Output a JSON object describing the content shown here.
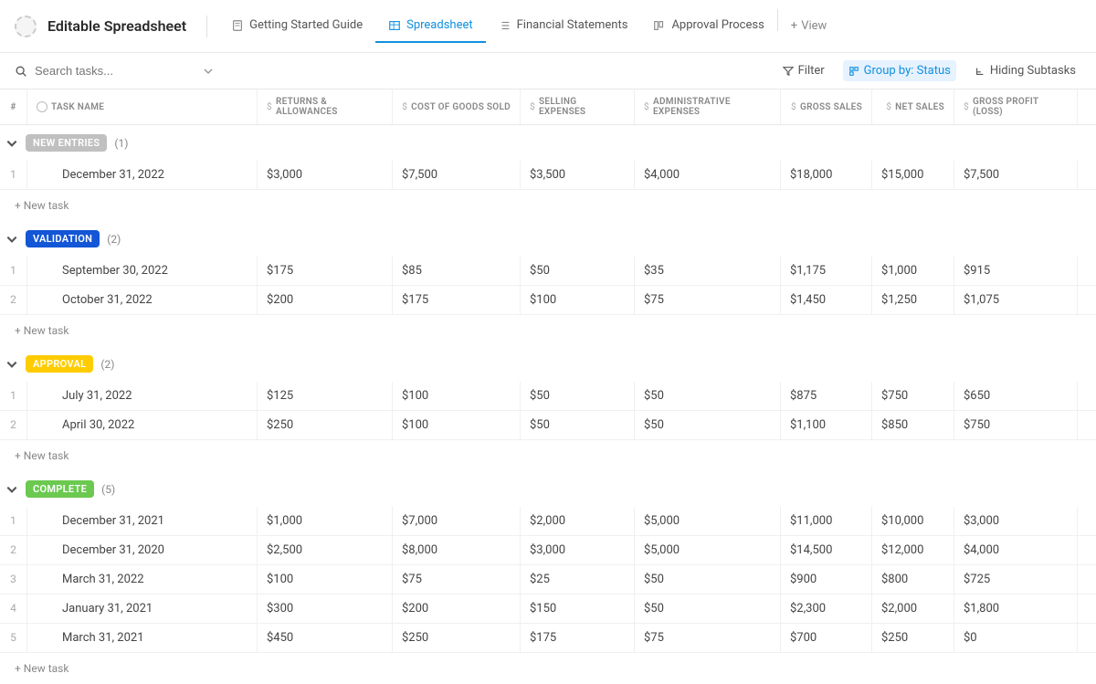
{
  "header": {
    "title": "Editable Spreadsheet",
    "tabs": [
      {
        "label": "Getting Started Guide",
        "active": false
      },
      {
        "label": "Spreadsheet",
        "active": true
      },
      {
        "label": "Financial Statements",
        "active": false
      },
      {
        "label": "Approval Process",
        "active": false
      }
    ],
    "addView": "View"
  },
  "toolbar": {
    "searchPlaceholder": "Search tasks...",
    "filter": "Filter",
    "groupBy": "Group by: Status",
    "hidingSubtasks": "Hiding Subtasks"
  },
  "columns": {
    "num": "#",
    "name": "TASK NAME",
    "returns": "RETURNS & ALLOWANCES",
    "cogs": "COST OF GOODS SOLD",
    "selling": "SELLING EXPENSES",
    "admin": "ADMINISTRATIVE EXPENSES",
    "gross": "GROSS SALES",
    "net": "NET SALES",
    "profit": "GROSS PROFIT (LOSS)"
  },
  "newTask": "+ New task",
  "groups": [
    {
      "label": "NEW ENTRIES",
      "badgeClass": "badge-new",
      "count": "(1)",
      "rows": [
        {
          "num": "1",
          "name": "December 31, 2022",
          "returns": "$3,000",
          "cogs": "$7,500",
          "selling": "$3,500",
          "admin": "$4,000",
          "gross": "$18,000",
          "net": "$15,000",
          "profit": "$7,500"
        }
      ]
    },
    {
      "label": "VALIDATION",
      "badgeClass": "badge-validation",
      "count": "(2)",
      "rows": [
        {
          "num": "1",
          "name": "September 30, 2022",
          "returns": "$175",
          "cogs": "$85",
          "selling": "$50",
          "admin": "$35",
          "gross": "$1,175",
          "net": "$1,000",
          "profit": "$915"
        },
        {
          "num": "2",
          "name": "October 31, 2022",
          "returns": "$200",
          "cogs": "$175",
          "selling": "$100",
          "admin": "$75",
          "gross": "$1,450",
          "net": "$1,250",
          "profit": "$1,075"
        }
      ]
    },
    {
      "label": "APPROVAL",
      "badgeClass": "badge-approval",
      "count": "(2)",
      "rows": [
        {
          "num": "1",
          "name": "July 31, 2022",
          "returns": "$125",
          "cogs": "$100",
          "selling": "$50",
          "admin": "$50",
          "gross": "$875",
          "net": "$750",
          "profit": "$650"
        },
        {
          "num": "2",
          "name": "April 30, 2022",
          "returns": "$250",
          "cogs": "$100",
          "selling": "$50",
          "admin": "$50",
          "gross": "$1,100",
          "net": "$850",
          "profit": "$750"
        }
      ]
    },
    {
      "label": "COMPLETE",
      "badgeClass": "badge-complete",
      "count": "(5)",
      "rows": [
        {
          "num": "1",
          "name": "December 31, 2021",
          "returns": "$1,000",
          "cogs": "$7,000",
          "selling": "$2,000",
          "admin": "$5,000",
          "gross": "$11,000",
          "net": "$10,000",
          "profit": "$3,000"
        },
        {
          "num": "2",
          "name": "December 31, 2020",
          "returns": "$2,500",
          "cogs": "$8,000",
          "selling": "$3,000",
          "admin": "$5,000",
          "gross": "$14,500",
          "net": "$12,000",
          "profit": "$4,000"
        },
        {
          "num": "3",
          "name": "March 31, 2022",
          "returns": "$100",
          "cogs": "$75",
          "selling": "$25",
          "admin": "$50",
          "gross": "$900",
          "net": "$800",
          "profit": "$725"
        },
        {
          "num": "4",
          "name": "January 31, 2021",
          "returns": "$300",
          "cogs": "$200",
          "selling": "$150",
          "admin": "$50",
          "gross": "$2,300",
          "net": "$2,000",
          "profit": "$1,800"
        },
        {
          "num": "5",
          "name": "March 31, 2021",
          "returns": "$450",
          "cogs": "$250",
          "selling": "$175",
          "admin": "$75",
          "gross": "$700",
          "net": "$250",
          "profit": "$0"
        }
      ]
    }
  ]
}
